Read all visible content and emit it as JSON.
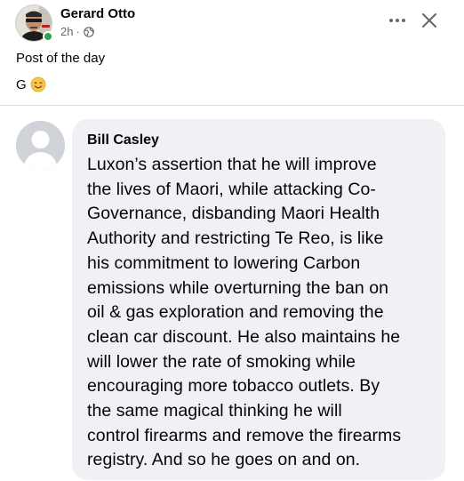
{
  "post": {
    "author": "Gerard Otto",
    "time": "2h",
    "separator": "·",
    "text": "Post of the day",
    "signoff": "G"
  },
  "icons": {
    "more": "more-horizontal-icon",
    "close": "close-icon",
    "audience": "globe-icon",
    "emoji": "smiling-face-icon",
    "commenter_avatar": "default-user-avatar"
  },
  "comment": {
    "author": "Bill Casley",
    "lines": [
      "Luxon’s assertion that he will improve",
      "the lives of Maori, while attacking Co-",
      "Governance, disbanding Maori Health",
      "Authority and restricting Te Reo, is like",
      "his commitment to lowering Carbon",
      "emissions while overturning the ban on",
      "oil & gas exploration and removing the",
      "clean car discount. He also maintains he",
      "will lower the rate of smoking while",
      "encouraging more tobacco outlets. By",
      "the same magical thinking he will",
      "control firearms and remove the firearms",
      "registry. And so he goes on and on."
    ]
  },
  "colors": {
    "online": "#31a24c",
    "bubble": "#eff1f4",
    "meta_text": "#65676b",
    "divider": "#dcdde1"
  }
}
